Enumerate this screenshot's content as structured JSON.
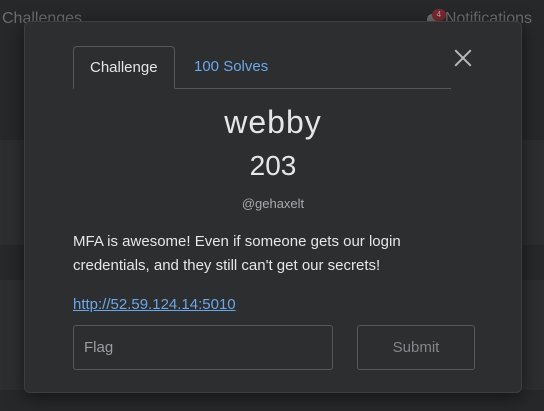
{
  "background": {
    "nav_left_label": "Challenges",
    "notifications_label": "Notifications",
    "notifications_count": "4"
  },
  "modal": {
    "tabs": [
      {
        "label": "Challenge",
        "active": true
      },
      {
        "label": "100 Solves",
        "active": false
      }
    ],
    "challenge_name": "webby",
    "points": "203",
    "author": "@gehaxelt",
    "description": "MFA is awesome! Even if someone gets our login credentials, and they still can't get our secrets!",
    "link": "http://52.59.124.14:5010",
    "flag_input": {
      "placeholder": "Flag",
      "value": ""
    },
    "submit_label": "Submit",
    "close_icon": "close-icon"
  },
  "colors": {
    "modal_bg": "#2c2e30",
    "link": "#6aa8e8",
    "text": "#e4e6e9",
    "muted": "#a7aaae"
  }
}
